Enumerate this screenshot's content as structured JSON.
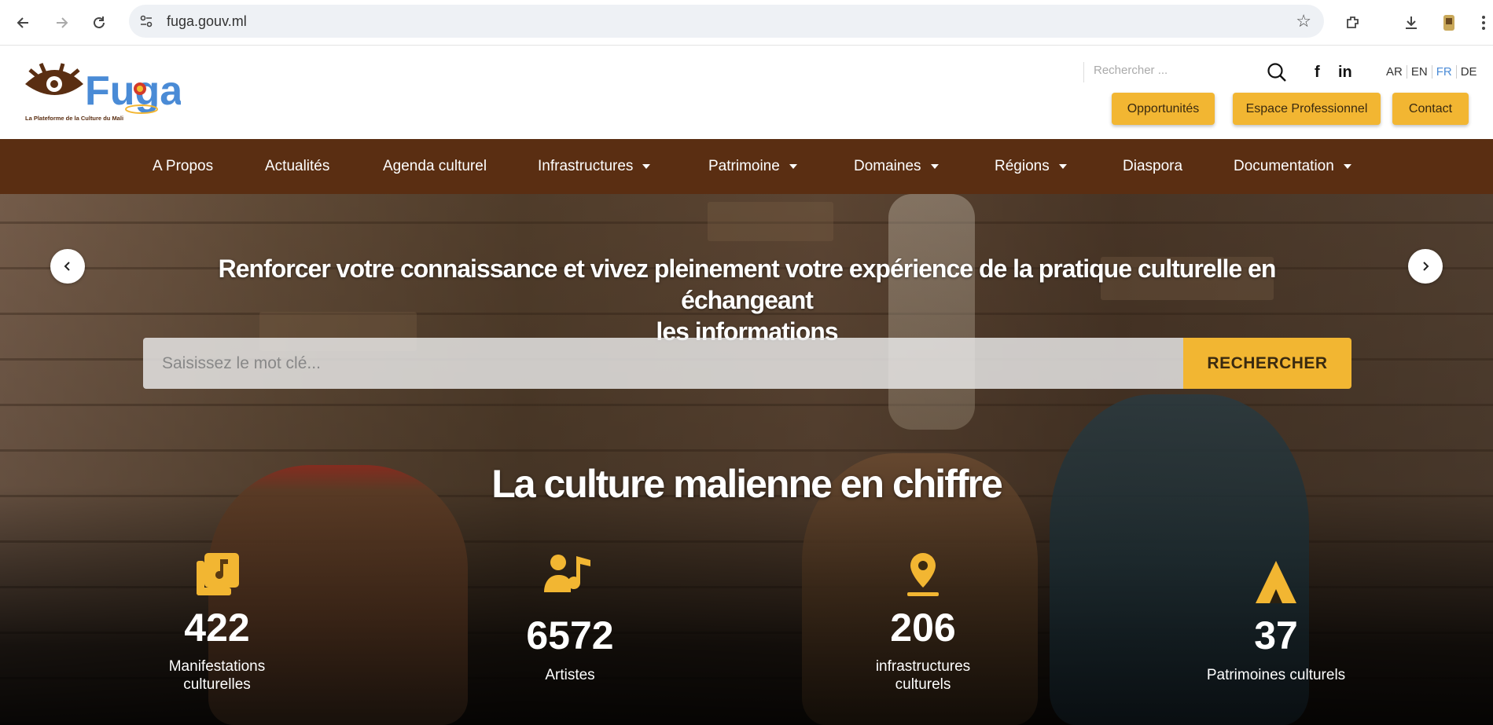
{
  "browser": {
    "url": "fuga.gouv.ml",
    "icons": [
      "back-arrow-icon",
      "forward-arrow-icon",
      "reload-icon",
      "site-info-icon",
      "bookmark-star-icon",
      "extensions-icon",
      "download-icon",
      "profile-icon"
    ]
  },
  "header": {
    "logo_text": "Fuga",
    "logo_tagline": "La Plateforme de la Culture du Mali",
    "search_placeholder": "Rechercher ...",
    "social": {
      "facebook": "f",
      "linkedin": "in"
    },
    "languages": [
      "AR",
      "EN",
      "FR",
      "DE"
    ],
    "active_language": "FR",
    "buttons": {
      "opportunites": "Opportunités",
      "espace_pro": "Espace Professionnel",
      "contact": "Contact"
    }
  },
  "nav": {
    "items": [
      {
        "label": "A Propos",
        "dropdown": false
      },
      {
        "label": "Actualités",
        "dropdown": false
      },
      {
        "label": "Agenda culturel",
        "dropdown": false
      },
      {
        "label": "Infrastructures",
        "dropdown": true
      },
      {
        "label": "Patrimoine",
        "dropdown": true
      },
      {
        "label": "Domaines",
        "dropdown": true
      },
      {
        "label": "Régions",
        "dropdown": true
      },
      {
        "label": "Diaspora",
        "dropdown": false
      },
      {
        "label": "Documentation",
        "dropdown": true
      }
    ]
  },
  "hero": {
    "title_line1": "Renforcer votre connaissance et vivez pleinement votre expérience de la pratique culturelle en échangeant",
    "title_line2": "les informations",
    "search_placeholder": "Saisissez le mot clé...",
    "search_button": "RECHERCHER",
    "stats_title": "La culture malienne en chiffre",
    "stats": [
      {
        "value": "422",
        "label_line1": "Manifestations",
        "label_line2": "culturelles",
        "icon": "music-album-icon"
      },
      {
        "value": "6572",
        "label_line1": "Artistes",
        "label_line2": "",
        "icon": "artist-music-icon"
      },
      {
        "value": "206",
        "label_line1": "infrastructures",
        "label_line2": "culturels",
        "icon": "map-pin-icon"
      },
      {
        "value": "37",
        "label_line1": "Patrimoines culturels",
        "label_line2": "",
        "icon": "heritage-mountain-icon"
      }
    ]
  },
  "colors": {
    "nav_background": "#5a2e12",
    "accent_yellow": "#f2b632",
    "active_language": "#4a8bd6"
  }
}
